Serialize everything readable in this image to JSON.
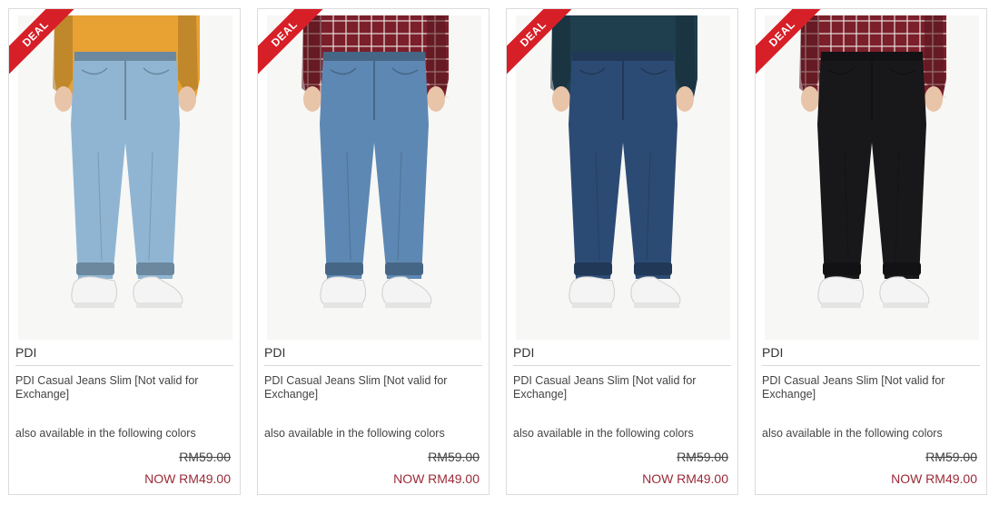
{
  "products": [
    {
      "badge": "DEAL",
      "brand": "PDI",
      "name": "PDI Casual Jeans Slim [Not valid for Exchange]",
      "colors_label": "also available in the following colors",
      "old_price": "RM59.00",
      "new_price": "NOW RM49.00",
      "shirt_color": "#e7a233",
      "shirt_pattern": "solid",
      "jeans_color": "#8fb5d3",
      "image": "jeans-photo"
    },
    {
      "badge": "DEAL",
      "brand": "PDI",
      "name": "PDI Casual Jeans Slim [Not valid for Exchange]",
      "colors_label": "also available in the following colors",
      "old_price": "RM59.00",
      "new_price": "NOW RM49.00",
      "shirt_color": "#7b1f2b",
      "shirt_pattern": "plaid",
      "jeans_color": "#5d88b3",
      "image": "jeans-photo"
    },
    {
      "badge": "DEAL",
      "brand": "PDI",
      "name": "PDI Casual Jeans Slim [Not valid for Exchange]",
      "colors_label": "also available in the following colors",
      "old_price": "RM59.00",
      "new_price": "NOW RM49.00",
      "shirt_color": "#1f3e4e",
      "shirt_pattern": "solid",
      "jeans_color": "#2c4b74",
      "image": "jeans-photo"
    },
    {
      "badge": "DEAL",
      "brand": "PDI",
      "name": "PDI Casual Jeans Slim [Not valid for Exchange]",
      "colors_label": "also available in the following colors",
      "old_price": "RM59.00",
      "new_price": "NOW RM49.00",
      "shirt_color": "#7b1f2b",
      "shirt_pattern": "plaid",
      "jeans_color": "#18181a",
      "image": "jeans-photo"
    }
  ],
  "colors": {
    "deal_badge": "#d71f27",
    "price_now": "#9a2a38",
    "border": "#dcdcdc"
  }
}
